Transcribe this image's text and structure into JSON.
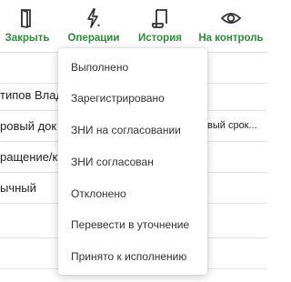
{
  "toolbar": {
    "close_label": "Закрыть",
    "operations_label": "Операции",
    "history_label": "История",
    "control_label": "На контроль",
    "accent_color": "#2e8b3c"
  },
  "background": {
    "row1_left": "типов Влад",
    "row2_left": "ровый док",
    "row2_right": "вый срок...",
    "row3_left": "ращение/к",
    "row4_left": "ычный"
  },
  "menu": {
    "items": [
      "Выполнено",
      "Зарегистрировано",
      "ЗНИ на согласовании",
      "ЗНИ согласован",
      "Отклонено",
      "Перевести в уточнение",
      "Принято к исполнению"
    ]
  }
}
